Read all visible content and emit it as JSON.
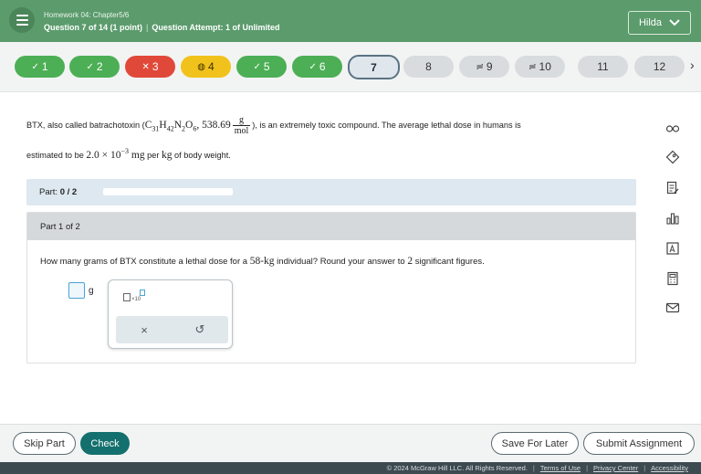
{
  "header": {
    "homework": "Homework 04: Chapter5/6",
    "question": "Question 7 of 14 (1 point)",
    "separator": "|",
    "attempt": "Question Attempt: 1 of Unlimited",
    "user": "Hilda"
  },
  "nav": {
    "questions": [
      {
        "label": "1",
        "icon": "✓",
        "status": "correct"
      },
      {
        "label": "2",
        "icon": "✓",
        "status": "correct"
      },
      {
        "label": "3",
        "icon": "✕",
        "status": "incorrect"
      },
      {
        "label": "4",
        "icon": "◍",
        "status": "partial"
      },
      {
        "label": "5",
        "icon": "✓",
        "status": "correct"
      },
      {
        "label": "6",
        "icon": "✓",
        "status": "correct"
      },
      {
        "label": "7",
        "icon": "",
        "status": "current"
      },
      {
        "label": "8",
        "icon": "",
        "status": "unanswered"
      },
      {
        "label": "9",
        "icon": "≓",
        "status": "unanswered"
      },
      {
        "label": "10",
        "icon": "≓",
        "status": "unanswered"
      },
      {
        "label": "11",
        "icon": "",
        "status": "unanswered"
      },
      {
        "label": "12",
        "icon": "",
        "status": "unanswered"
      }
    ],
    "next_icon": "›"
  },
  "question": {
    "intro_a": "BTX, also called batrachotoxin (",
    "formula_c": "C",
    "sub_c": "31",
    "formula_h": "H",
    "sub_h": "42",
    "formula_n": "N",
    "sub_n": "2",
    "formula_o": "O",
    "sub_o": "6",
    "comma": ",",
    "molar_mass": "538.69",
    "unit_num": "g",
    "unit_den": "mol",
    "intro_b": "), is an extremely toxic compound. The average lethal dose in humans is",
    "line2_a": "estimated to be ",
    "dose_coeff": "2.0 × 10",
    "dose_exp": "−3",
    "dose_unit": "mg",
    "per": " per ",
    "kg": "kg",
    "line2_b": " of body weight."
  },
  "part_bar": {
    "label": "Part:",
    "progress": "0 / 2",
    "fraction": 0
  },
  "part": {
    "header": "Part 1 of 2",
    "ask_a": "How many grams of BTX constitute a lethal dose for a ",
    "mass": "58",
    "mass_unit": "kg",
    "ask_b": " individual? Round your answer to ",
    "sigfigs": "2",
    "ask_c": " significant figures.",
    "answer_value": "",
    "answer_unit": "g",
    "sci_label": "×10",
    "clear_icon": "×",
    "undo_icon": "↺"
  },
  "footer": {
    "skip": "Skip Part",
    "check": "Check",
    "save": "Save For Later",
    "submit": "Submit Assignment"
  },
  "copyright": {
    "text": "© 2024 McGraw Hill LLC. All Rights Reserved.",
    "terms": "Terms of Use",
    "privacy": "Privacy Center",
    "access": "Accessibility",
    "sep": "|"
  },
  "colors": {
    "header": "#5b9b6c",
    "correct": "#4caf55",
    "incorrect": "#e0493a",
    "partial": "#f1c21b",
    "primary": "#14706e"
  },
  "tools": [
    "glasses-icon",
    "tag-icon",
    "notes-icon",
    "chart-icon",
    "textbook-icon",
    "calculator-icon",
    "mail-icon"
  ]
}
